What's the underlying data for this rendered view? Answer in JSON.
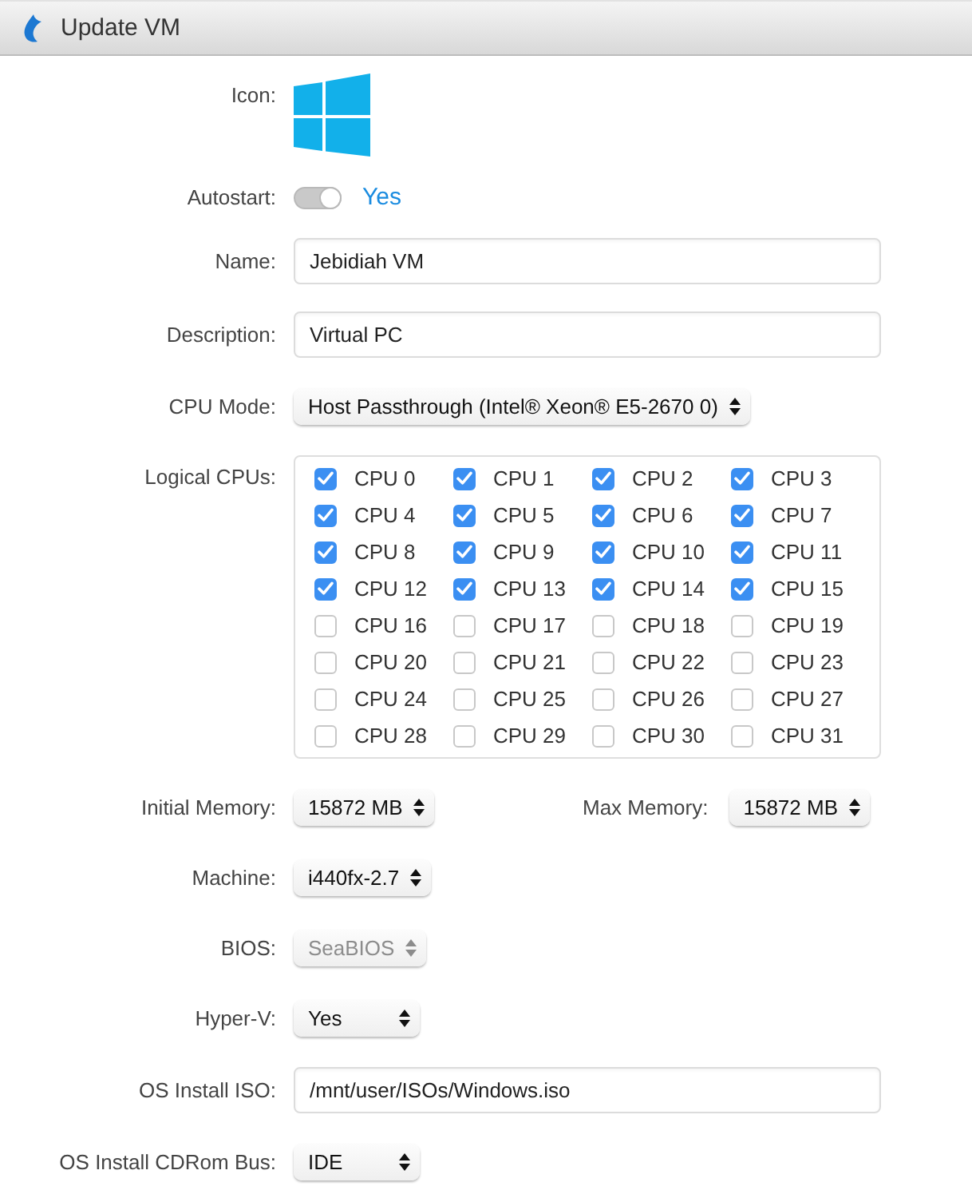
{
  "window": {
    "title": "Update VM"
  },
  "form": [
    {
      "kind": "icon",
      "label": "Icon:"
    },
    {
      "kind": "toggle",
      "label": "Autostart:",
      "on": true,
      "value": "Yes"
    },
    {
      "kind": "text",
      "label": "Name:",
      "value": "Jebidiah VM"
    },
    {
      "kind": "text",
      "label": "Description:",
      "value": "Virtual PC"
    },
    {
      "kind": "select",
      "label": "CPU Mode:",
      "value": "Host Passthrough (Intel® Xeon® E5-2670 0)",
      "disabled": false
    },
    {
      "kind": "cpus",
      "label": "Logical CPUs:",
      "cpus": [
        {
          "label": "CPU 0",
          "checked": true
        },
        {
          "label": "CPU 1",
          "checked": true
        },
        {
          "label": "CPU 2",
          "checked": true
        },
        {
          "label": "CPU 3",
          "checked": true
        },
        {
          "label": "CPU 4",
          "checked": true
        },
        {
          "label": "CPU 5",
          "checked": true
        },
        {
          "label": "CPU 6",
          "checked": true
        },
        {
          "label": "CPU 7",
          "checked": true
        },
        {
          "label": "CPU 8",
          "checked": true
        },
        {
          "label": "CPU 9",
          "checked": true
        },
        {
          "label": "CPU 10",
          "checked": true
        },
        {
          "label": "CPU 11",
          "checked": true
        },
        {
          "label": "CPU 12",
          "checked": true
        },
        {
          "label": "CPU 13",
          "checked": true
        },
        {
          "label": "CPU 14",
          "checked": true
        },
        {
          "label": "CPU 15",
          "checked": true
        },
        {
          "label": "CPU 16",
          "checked": false
        },
        {
          "label": "CPU 17",
          "checked": false
        },
        {
          "label": "CPU 18",
          "checked": false
        },
        {
          "label": "CPU 19",
          "checked": false
        },
        {
          "label": "CPU 20",
          "checked": false
        },
        {
          "label": "CPU 21",
          "checked": false
        },
        {
          "label": "CPU 22",
          "checked": false
        },
        {
          "label": "CPU 23",
          "checked": false
        },
        {
          "label": "CPU 24",
          "checked": false
        },
        {
          "label": "CPU 25",
          "checked": false
        },
        {
          "label": "CPU 26",
          "checked": false
        },
        {
          "label": "CPU 27",
          "checked": false
        },
        {
          "label": "CPU 28",
          "checked": false
        },
        {
          "label": "CPU 29",
          "checked": false
        },
        {
          "label": "CPU 30",
          "checked": false
        },
        {
          "label": "CPU 31",
          "checked": false
        }
      ]
    },
    {
      "kind": "select_pair",
      "items": [
        {
          "label": "Initial Memory:",
          "value": "15872 MB",
          "disabled": false
        },
        {
          "label": "Max Memory:",
          "value": "15872 MB",
          "disabled": false
        }
      ]
    },
    {
      "kind": "select",
      "label": "Machine:",
      "value": "i440fx-2.7",
      "disabled": false
    },
    {
      "kind": "select",
      "label": "BIOS:",
      "value": "SeaBIOS",
      "disabled": true
    },
    {
      "kind": "select",
      "label": "Hyper-V:",
      "value": "Yes",
      "disabled": false
    },
    {
      "kind": "text",
      "label": "OS Install ISO:",
      "value": "/mnt/user/ISOs/Windows.iso"
    },
    {
      "kind": "select",
      "label": "OS Install CDRom Bus:",
      "value": "IDE",
      "disabled": false
    }
  ]
}
